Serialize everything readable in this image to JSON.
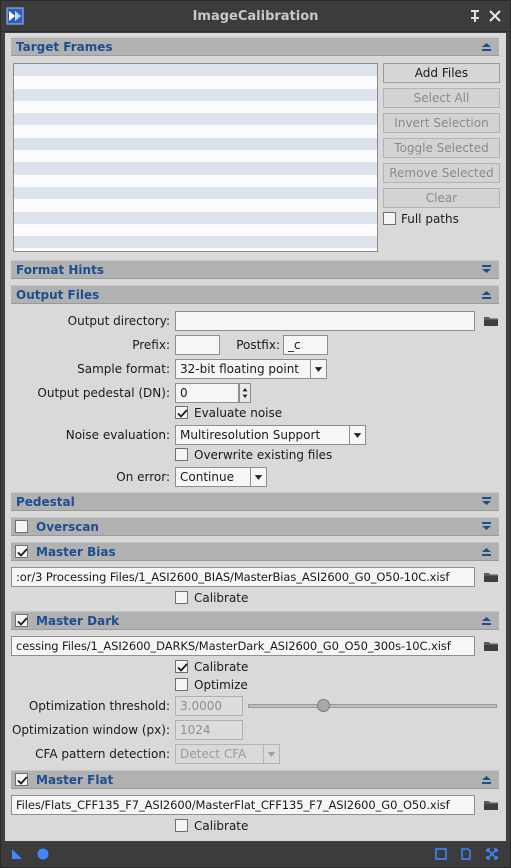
{
  "window": {
    "title": "ImageCalibration",
    "pin_icon": "pin-icon",
    "close_icon": "close-icon"
  },
  "colors": {
    "section_label": "#1d4e91",
    "section_bar": "#b1b1b1",
    "panel_bg": "#d9d9d9",
    "frame_bg": "#3c3c3c"
  },
  "target_frames": {
    "title": "Target Frames",
    "buttons": {
      "add_files": "Add Files",
      "select_all": "Select All",
      "invert_selection": "Invert Selection",
      "toggle_selected": "Toggle Selected",
      "remove_selected": "Remove Selected",
      "clear": "Clear"
    },
    "full_paths_label": "Full paths",
    "full_paths_checked": false
  },
  "format_hints": {
    "title": "Format Hints"
  },
  "output_files": {
    "title": "Output Files",
    "output_directory_label": "Output directory:",
    "output_directory_value": "",
    "prefix_label": "Prefix:",
    "prefix_value": "",
    "postfix_label": "Postfix:",
    "postfix_value": "_c",
    "sample_format_label": "Sample format:",
    "sample_format_value": "32-bit floating point",
    "output_pedestal_label": "Output pedestal (DN):",
    "output_pedestal_value": "0",
    "evaluate_noise_label": "Evaluate noise",
    "evaluate_noise_checked": true,
    "noise_evaluation_label": "Noise evaluation:",
    "noise_evaluation_value": "Multiresolution Support",
    "overwrite_label": "Overwrite existing files",
    "overwrite_checked": false,
    "on_error_label": "On error:",
    "on_error_value": "Continue"
  },
  "pedestal": {
    "title": "Pedestal"
  },
  "overscan": {
    "title": "Overscan",
    "checked": false
  },
  "master_bias": {
    "title": "Master Bias",
    "checked": true,
    "path": ":or/3 Processing Files/1_ASI2600_BIAS/MasterBias_ASI2600_G0_O50-10C.xisf",
    "calibrate_label": "Calibrate",
    "calibrate_checked": false
  },
  "master_dark": {
    "title": "Master Dark",
    "checked": true,
    "path": "cessing Files/1_ASI2600_DARKS/MasterDark_ASI2600_G0_O50_300s-10C.xisf",
    "calibrate_label": "Calibrate",
    "calibrate_checked": true,
    "optimize_label": "Optimize",
    "optimize_checked": false,
    "optimization_threshold_label": "Optimization threshold:",
    "optimization_threshold_value": "3.0000",
    "optimization_threshold_level": 0.3,
    "optimization_window_label": "Optimization window (px):",
    "optimization_window_value": "1024",
    "cfa_label": "CFA pattern detection:",
    "cfa_value": "Detect CFA"
  },
  "master_flat": {
    "title": "Master Flat",
    "checked": true,
    "path": "Files/Flats_CFF135_F7_ASI2600/MasterFlat_CFF135_F7_ASI2600_G0_O50.xisf",
    "calibrate_label": "Calibrate",
    "calibrate_checked": false
  },
  "statusbar": {
    "icons": [
      "new-instance-icon",
      "apply-global-icon",
      "browse-docs-icon",
      "edit-icon",
      "reset-icon"
    ]
  }
}
